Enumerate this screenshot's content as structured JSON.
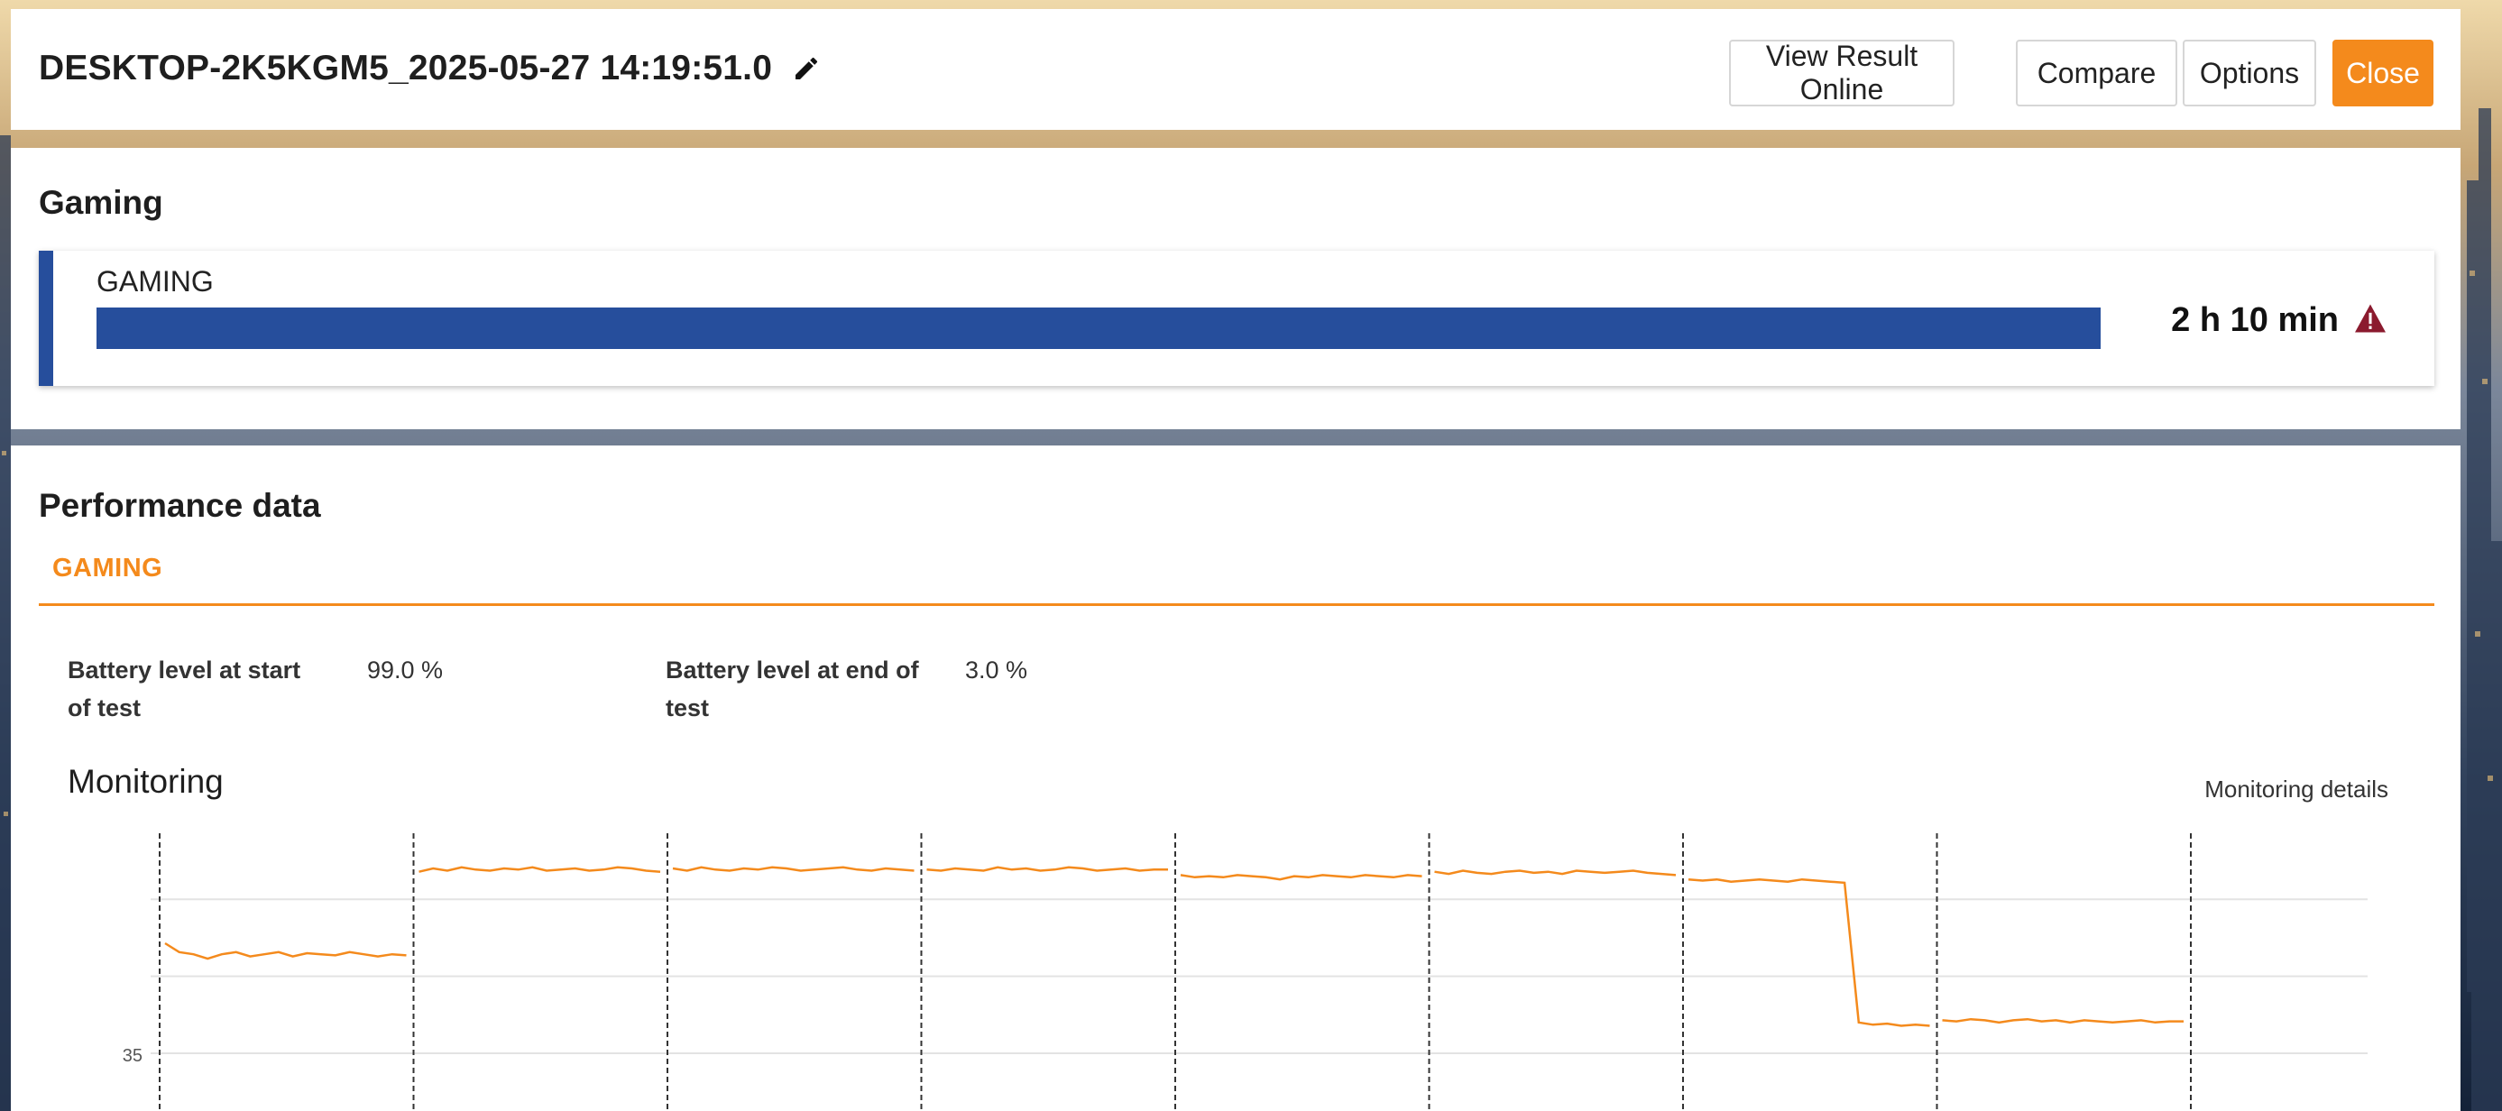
{
  "header": {
    "title": "DESKTOP-2K5KGM5_2025-05-27 14:19:51.0",
    "buttons": {
      "view_online": "View Result Online",
      "compare": "Compare",
      "options": "Options",
      "close": "Close"
    },
    "accent_color": "#f48a1c"
  },
  "gaming": {
    "section_title": "Gaming",
    "card_label": "GAMING",
    "result": "2 h 10 min",
    "progress_fraction": 1.0,
    "bar_color": "#264e9c",
    "warning_icon": "warning-triangle-icon",
    "warning_color": "#8b1a2e"
  },
  "performance": {
    "section_title": "Performance data",
    "tab_label": "GAMING",
    "battery_start_label": "Battery level at start of test",
    "battery_start_value": "99.0 %",
    "battery_end_label": "Battery level at end of test",
    "battery_end_value": "3.0 %",
    "monitoring_title": "Monitoring",
    "monitoring_details_label": "Monitoring details"
  },
  "chart_data": {
    "type": "line",
    "title": "",
    "ytick_labels": [
      "35"
    ],
    "grid": true,
    "line_color": "#f48a1c",
    "x": [
      0,
      1,
      2,
      3,
      4,
      5,
      6,
      7,
      8,
      9,
      10,
      11,
      12,
      13,
      14,
      15,
      16,
      17
    ],
    "series": [
      {
        "values": [
          [
            45.0,
            44.2,
            44.0,
            43.6,
            44.0,
            44.2,
            43.8,
            44.0,
            44.2,
            43.8,
            44.1,
            44.0,
            43.9,
            44.2,
            44.0,
            43.8,
            44.0,
            43.9
          ],
          [
            51.5,
            51.8,
            51.6,
            51.9,
            51.7,
            51.6,
            51.8,
            51.7,
            51.9,
            51.6,
            51.7,
            51.8,
            51.6,
            51.7,
            51.9,
            51.8,
            51.6,
            51.5
          ],
          [
            51.8,
            51.6,
            51.9,
            51.7,
            51.6,
            51.8,
            51.7,
            51.9,
            51.8,
            51.6,
            51.7,
            51.8,
            51.9,
            51.7,
            51.6,
            51.8,
            51.7,
            51.6
          ],
          [
            51.7,
            51.6,
            51.8,
            51.7,
            51.6,
            51.9,
            51.7,
            51.8,
            51.6,
            51.7,
            51.9,
            51.8,
            51.6,
            51.7,
            51.8,
            51.6,
            51.7,
            51.7
          ],
          [
            51.2,
            51.0,
            51.1,
            51.0,
            51.2,
            51.1,
            51.0,
            50.8,
            51.1,
            51.0,
            51.2,
            51.1,
            51.0,
            51.2,
            51.1,
            51.0,
            51.2,
            51.1
          ],
          [
            51.5,
            51.3,
            51.6,
            51.4,
            51.3,
            51.5,
            51.6,
            51.4,
            51.5,
            51.3,
            51.6,
            51.5,
            51.4,
            51.5,
            51.6,
            51.4,
            51.3,
            51.2
          ],
          [
            50.8,
            50.7,
            50.8,
            50.6,
            50.7,
            50.8,
            50.7,
            50.6,
            50.8,
            50.7,
            50.6,
            50.5,
            37.8,
            37.6,
            37.7,
            37.5,
            37.6,
            37.5
          ],
          [
            38.0,
            37.9,
            38.1,
            38.0,
            37.8,
            38.0,
            38.1,
            37.9,
            38.0,
            37.8,
            38.0,
            37.9,
            37.8,
            37.9,
            38.0,
            37.8,
            37.9,
            37.9
          ]
        ]
      }
    ]
  }
}
